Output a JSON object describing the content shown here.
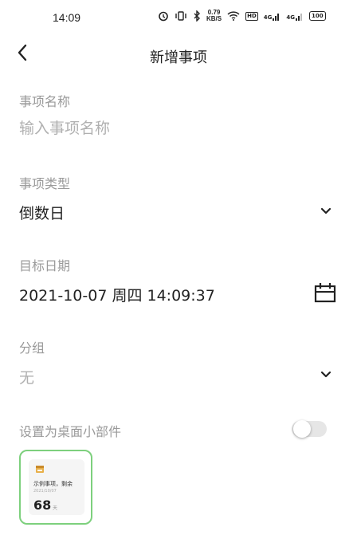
{
  "status_bar": {
    "time": "14:09",
    "speed_value": "0.79",
    "speed_unit": "KB/S",
    "hd_label": "HD",
    "signal1_label": "4G",
    "signal2_label": "4G",
    "battery": "100"
  },
  "header": {
    "title": "新增事项",
    "back_icon": "chevron-left-icon"
  },
  "form": {
    "name": {
      "label": "事项名称",
      "placeholder": "输入事项名称",
      "value": ""
    },
    "type": {
      "label": "事项类型",
      "value": "倒数日",
      "icon": "chevron-down-icon"
    },
    "date": {
      "label": "目标日期",
      "value": "2021-10-07 周四 14:09:37",
      "icon": "calendar-icon"
    },
    "group": {
      "label": "分组",
      "value": "无",
      "icon": "chevron-down-icon"
    },
    "widget_toggle": {
      "label": "设置为桌面小部件",
      "checked": false
    }
  },
  "widget_preview": {
    "title": "示例事项，剩余",
    "date": "2021/10/07",
    "days": "68",
    "unit": "天",
    "border_color": "#7dd07d"
  }
}
